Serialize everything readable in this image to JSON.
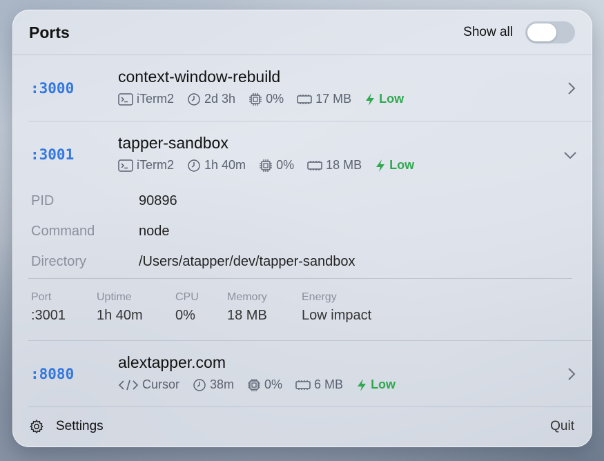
{
  "header": {
    "title": "Ports",
    "show_all_label": "Show all",
    "show_all_on": false
  },
  "processes": [
    {
      "port": ":3000",
      "name": "context-window-rebuild",
      "app_icon": "terminal-icon",
      "app": "iTerm2",
      "uptime": "2d 3h",
      "cpu": "0%",
      "memory": "17 MB",
      "energy": "Low",
      "expanded": false
    },
    {
      "port": ":3001",
      "name": "tapper-sandbox",
      "app_icon": "terminal-icon",
      "app": "iTerm2",
      "uptime": "1h 40m",
      "cpu": "0%",
      "memory": "18 MB",
      "energy": "Low",
      "expanded": true,
      "details": {
        "pid_label": "PID",
        "pid": "90896",
        "command_label": "Command",
        "command": "node",
        "directory_label": "Directory",
        "directory": "/Users/atapper/dev/tapper-sandbox"
      },
      "stats": {
        "port_label": "Port",
        "port": ":3001",
        "uptime_label": "Uptime",
        "uptime": "1h 40m",
        "cpu_label": "CPU",
        "cpu": "0%",
        "memory_label": "Memory",
        "memory": "18 MB",
        "energy_label": "Energy",
        "energy": "Low impact"
      }
    },
    {
      "port": ":8080",
      "name": "alextapper.com",
      "app_icon": "code-icon",
      "app": "Cursor",
      "uptime": "38m",
      "cpu": "0%",
      "memory": "6 MB",
      "energy": "Low",
      "expanded": false
    }
  ],
  "footer": {
    "settings_label": "Settings",
    "quit_label": "Quit"
  },
  "colors": {
    "port": "#3478e0",
    "energy_low": "#2fa84f"
  }
}
